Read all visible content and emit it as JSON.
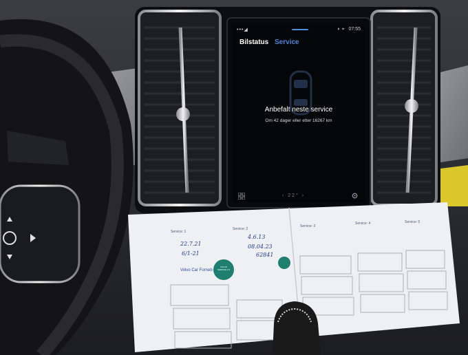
{
  "screen": {
    "status_bar": {
      "left_indicator": "•••◢",
      "right_icons": "◐ ⌖",
      "time": "07:55"
    },
    "tabs": [
      {
        "label": "Bilstatus",
        "active": false
      },
      {
        "label": "Service",
        "active": true
      }
    ],
    "headline": "Anbefalt neste service",
    "subline": "Om 42 dager eller etter 16267 km",
    "bottom_bar": {
      "temperature": "‹ 22° ›",
      "grid_icon": "grid-icon",
      "settings_icon": "settings-icon"
    },
    "accent_color": "#4c86d9"
  },
  "service_booklet": {
    "labels": [
      "Service: 1",
      "Service: 2",
      "Service: 3",
      "Service: 4",
      "Service: 5"
    ],
    "dealer_stamp": "Volvo Car Forneb",
    "badge_text": "VOLVO SERVICE 2.0",
    "handwriting": [
      "22.7.21",
      "6/1-21",
      "4.6.13",
      "08.04.23",
      "62841"
    ]
  }
}
